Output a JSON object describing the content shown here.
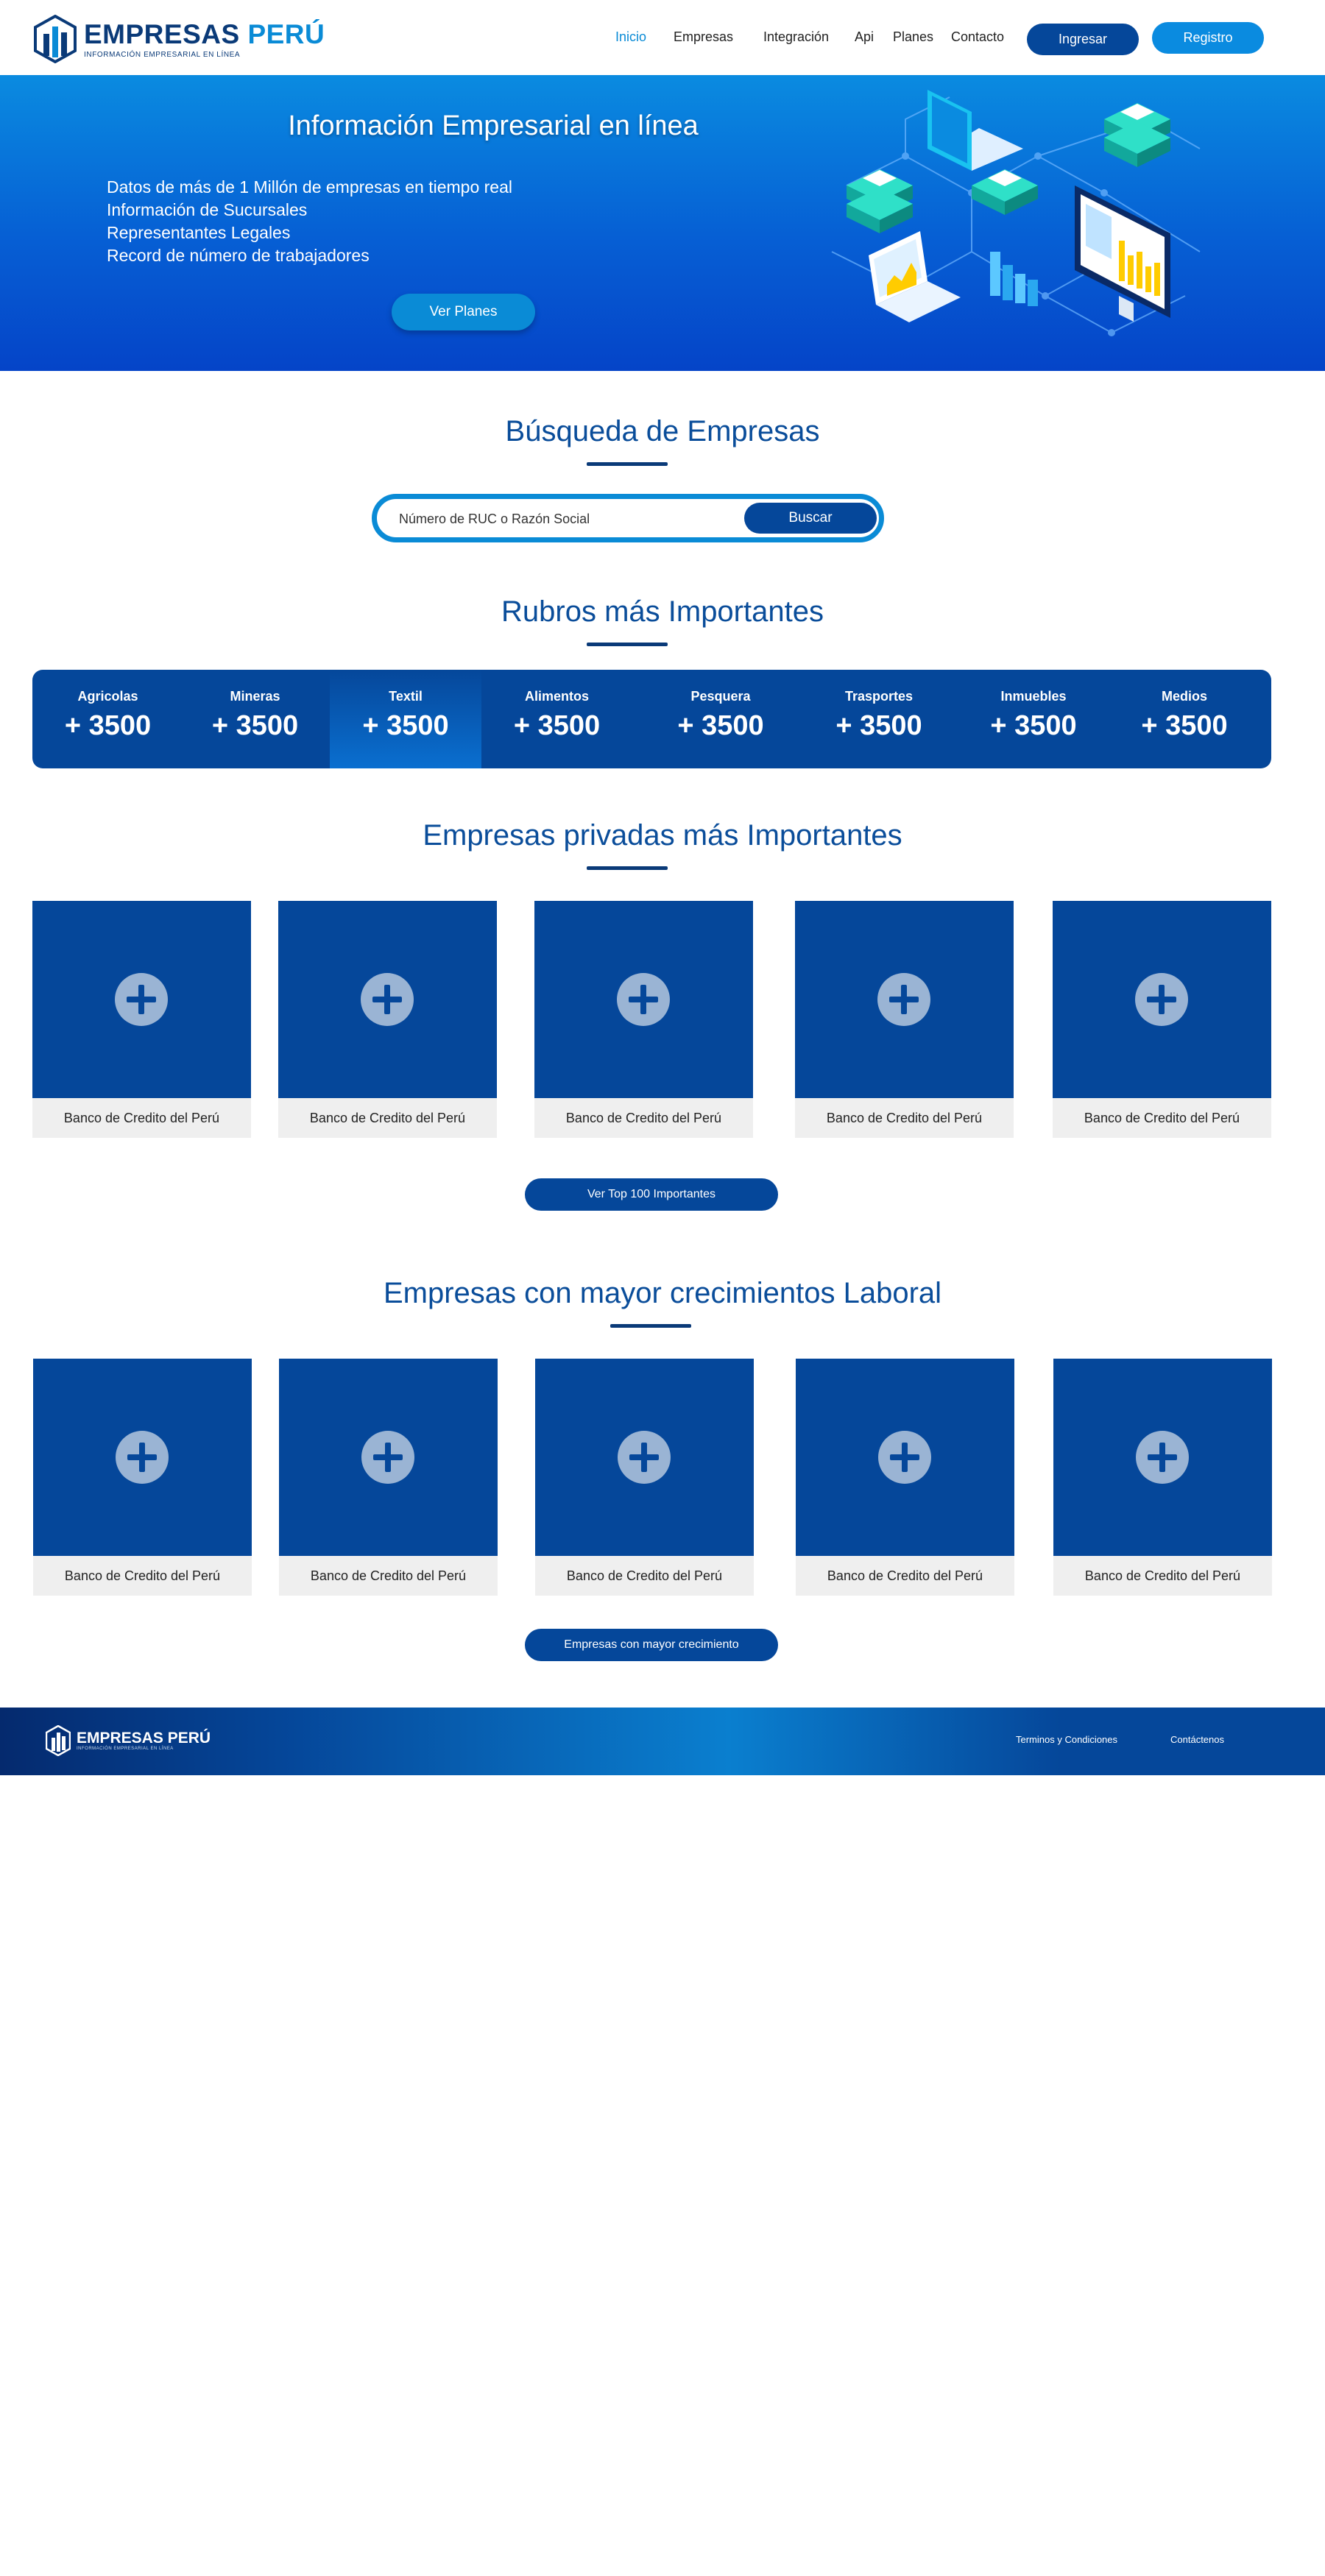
{
  "header": {
    "logo_title_main": "EMPRESAS",
    "logo_title_accent": "PERÚ",
    "logo_subtitle": "INFORMACIÓN EMPRESARIAL EN LÍNEA",
    "nav": [
      "Inicio",
      "Empresas",
      "Integración",
      "Api",
      "Planes",
      "Contacto"
    ],
    "login_label": "Ingresar",
    "register_label": "Registro"
  },
  "hero": {
    "title": "Información Empresarial en línea",
    "bullets": [
      "Datos de más de 1 Millón de empresas en tiempo real",
      "Información de Sucursales",
      "Representantes Legales",
      "Record de número de trabajadores"
    ],
    "plans_label": "Ver Planes"
  },
  "search": {
    "title": "Búsqueda de Empresas",
    "placeholder": "Número de RUC o Razón Social",
    "button_label": "Buscar"
  },
  "rubros": {
    "title": "Rubros más Importantes",
    "items": [
      {
        "name": "Agricolas",
        "count": "+ 3500"
      },
      {
        "name": "Mineras",
        "count": "+ 3500"
      },
      {
        "name": "Textil",
        "count": "+ 3500"
      },
      {
        "name": "Alimentos",
        "count": "+ 3500"
      },
      {
        "name": "Pesquera",
        "count": "+ 3500"
      },
      {
        "name": "Trasportes",
        "count": "+ 3500"
      },
      {
        "name": "Inmuebles",
        "count": "+ 3500"
      },
      {
        "name": "Medios",
        "count": "+ 3500"
      }
    ]
  },
  "private_companies": {
    "title": "Empresas privadas más Importantes",
    "cards": [
      "Banco de Credito del Perú",
      "Banco de Credito del Perú",
      "Banco de Credito del Perú",
      "Banco de Credito del Perú",
      "Banco de Credito del Perú"
    ],
    "button_label": "Ver Top 100 Importantes"
  },
  "growth_companies": {
    "title": "Empresas con mayor crecimientos Laboral",
    "cards": [
      "Banco de Credito del Perú",
      "Banco de Credito del Perú",
      "Banco de Credito del Perú",
      "Banco de Credito del Perú",
      "Banco de Credito del Perú"
    ],
    "button_label": "Empresas con mayor crecimiento"
  },
  "footer": {
    "logo_title": "EMPRESAS PERÚ",
    "logo_subtitle": "INFORMACIÓN EMPRESARIAL EN LÍNEA",
    "links": [
      "Terminos y Condiciones",
      "Contáctenos"
    ]
  },
  "colors": {
    "primary": "#05479a",
    "accent": "#0a8be0",
    "heading": "#0a4d9a",
    "card_caption_bg": "#efefef"
  },
  "icons": [
    "building-logo-icon",
    "plus-icon",
    "laptop-chart-icon",
    "database-stack-icon",
    "monitor-chart-icon"
  ]
}
